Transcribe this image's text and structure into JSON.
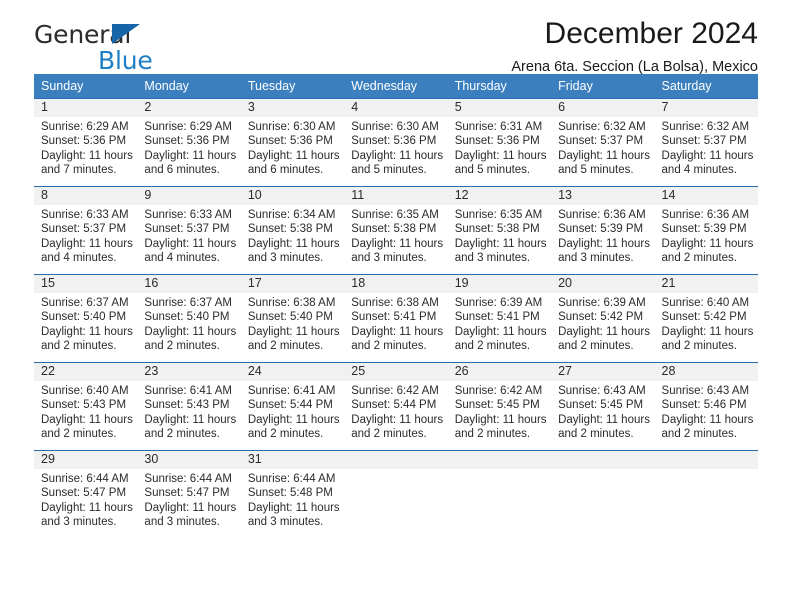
{
  "brand": {
    "line1": "General",
    "line2": "Blue",
    "triangle_color": "#1565a8",
    "blue_color": "#1f7fc4"
  },
  "header": {
    "title": "December 2024",
    "subtitle": "Arena 6ta. Seccion (La Bolsa), Mexico"
  },
  "calendar": {
    "header_bg": "#3b7fbf",
    "weekday_headers": [
      "Sunday",
      "Monday",
      "Tuesday",
      "Wednesday",
      "Thursday",
      "Friday",
      "Saturday"
    ],
    "weeks": [
      [
        {
          "day": "1",
          "sunrise": "Sunrise: 6:29 AM",
          "sunset": "Sunset: 5:36 PM",
          "daylight1": "Daylight: 11 hours",
          "daylight2": "and 7 minutes."
        },
        {
          "day": "2",
          "sunrise": "Sunrise: 6:29 AM",
          "sunset": "Sunset: 5:36 PM",
          "daylight1": "Daylight: 11 hours",
          "daylight2": "and 6 minutes."
        },
        {
          "day": "3",
          "sunrise": "Sunrise: 6:30 AM",
          "sunset": "Sunset: 5:36 PM",
          "daylight1": "Daylight: 11 hours",
          "daylight2": "and 6 minutes."
        },
        {
          "day": "4",
          "sunrise": "Sunrise: 6:30 AM",
          "sunset": "Sunset: 5:36 PM",
          "daylight1": "Daylight: 11 hours",
          "daylight2": "and 5 minutes."
        },
        {
          "day": "5",
          "sunrise": "Sunrise: 6:31 AM",
          "sunset": "Sunset: 5:36 PM",
          "daylight1": "Daylight: 11 hours",
          "daylight2": "and 5 minutes."
        },
        {
          "day": "6",
          "sunrise": "Sunrise: 6:32 AM",
          "sunset": "Sunset: 5:37 PM",
          "daylight1": "Daylight: 11 hours",
          "daylight2": "and 5 minutes."
        },
        {
          "day": "7",
          "sunrise": "Sunrise: 6:32 AM",
          "sunset": "Sunset: 5:37 PM",
          "daylight1": "Daylight: 11 hours",
          "daylight2": "and 4 minutes."
        }
      ],
      [
        {
          "day": "8",
          "sunrise": "Sunrise: 6:33 AM",
          "sunset": "Sunset: 5:37 PM",
          "daylight1": "Daylight: 11 hours",
          "daylight2": "and 4 minutes."
        },
        {
          "day": "9",
          "sunrise": "Sunrise: 6:33 AM",
          "sunset": "Sunset: 5:37 PM",
          "daylight1": "Daylight: 11 hours",
          "daylight2": "and 4 minutes."
        },
        {
          "day": "10",
          "sunrise": "Sunrise: 6:34 AM",
          "sunset": "Sunset: 5:38 PM",
          "daylight1": "Daylight: 11 hours",
          "daylight2": "and 3 minutes."
        },
        {
          "day": "11",
          "sunrise": "Sunrise: 6:35 AM",
          "sunset": "Sunset: 5:38 PM",
          "daylight1": "Daylight: 11 hours",
          "daylight2": "and 3 minutes."
        },
        {
          "day": "12",
          "sunrise": "Sunrise: 6:35 AM",
          "sunset": "Sunset: 5:38 PM",
          "daylight1": "Daylight: 11 hours",
          "daylight2": "and 3 minutes."
        },
        {
          "day": "13",
          "sunrise": "Sunrise: 6:36 AM",
          "sunset": "Sunset: 5:39 PM",
          "daylight1": "Daylight: 11 hours",
          "daylight2": "and 3 minutes."
        },
        {
          "day": "14",
          "sunrise": "Sunrise: 6:36 AM",
          "sunset": "Sunset: 5:39 PM",
          "daylight1": "Daylight: 11 hours",
          "daylight2": "and 2 minutes."
        }
      ],
      [
        {
          "day": "15",
          "sunrise": "Sunrise: 6:37 AM",
          "sunset": "Sunset: 5:40 PM",
          "daylight1": "Daylight: 11 hours",
          "daylight2": "and 2 minutes."
        },
        {
          "day": "16",
          "sunrise": "Sunrise: 6:37 AM",
          "sunset": "Sunset: 5:40 PM",
          "daylight1": "Daylight: 11 hours",
          "daylight2": "and 2 minutes."
        },
        {
          "day": "17",
          "sunrise": "Sunrise: 6:38 AM",
          "sunset": "Sunset: 5:40 PM",
          "daylight1": "Daylight: 11 hours",
          "daylight2": "and 2 minutes."
        },
        {
          "day": "18",
          "sunrise": "Sunrise: 6:38 AM",
          "sunset": "Sunset: 5:41 PM",
          "daylight1": "Daylight: 11 hours",
          "daylight2": "and 2 minutes."
        },
        {
          "day": "19",
          "sunrise": "Sunrise: 6:39 AM",
          "sunset": "Sunset: 5:41 PM",
          "daylight1": "Daylight: 11 hours",
          "daylight2": "and 2 minutes."
        },
        {
          "day": "20",
          "sunrise": "Sunrise: 6:39 AM",
          "sunset": "Sunset: 5:42 PM",
          "daylight1": "Daylight: 11 hours",
          "daylight2": "and 2 minutes."
        },
        {
          "day": "21",
          "sunrise": "Sunrise: 6:40 AM",
          "sunset": "Sunset: 5:42 PM",
          "daylight1": "Daylight: 11 hours",
          "daylight2": "and 2 minutes."
        }
      ],
      [
        {
          "day": "22",
          "sunrise": "Sunrise: 6:40 AM",
          "sunset": "Sunset: 5:43 PM",
          "daylight1": "Daylight: 11 hours",
          "daylight2": "and 2 minutes."
        },
        {
          "day": "23",
          "sunrise": "Sunrise: 6:41 AM",
          "sunset": "Sunset: 5:43 PM",
          "daylight1": "Daylight: 11 hours",
          "daylight2": "and 2 minutes."
        },
        {
          "day": "24",
          "sunrise": "Sunrise: 6:41 AM",
          "sunset": "Sunset: 5:44 PM",
          "daylight1": "Daylight: 11 hours",
          "daylight2": "and 2 minutes."
        },
        {
          "day": "25",
          "sunrise": "Sunrise: 6:42 AM",
          "sunset": "Sunset: 5:44 PM",
          "daylight1": "Daylight: 11 hours",
          "daylight2": "and 2 minutes."
        },
        {
          "day": "26",
          "sunrise": "Sunrise: 6:42 AM",
          "sunset": "Sunset: 5:45 PM",
          "daylight1": "Daylight: 11 hours",
          "daylight2": "and 2 minutes."
        },
        {
          "day": "27",
          "sunrise": "Sunrise: 6:43 AM",
          "sunset": "Sunset: 5:45 PM",
          "daylight1": "Daylight: 11 hours",
          "daylight2": "and 2 minutes."
        },
        {
          "day": "28",
          "sunrise": "Sunrise: 6:43 AM",
          "sunset": "Sunset: 5:46 PM",
          "daylight1": "Daylight: 11 hours",
          "daylight2": "and 2 minutes."
        }
      ],
      [
        {
          "day": "29",
          "sunrise": "Sunrise: 6:44 AM",
          "sunset": "Sunset: 5:47 PM",
          "daylight1": "Daylight: 11 hours",
          "daylight2": "and 3 minutes."
        },
        {
          "day": "30",
          "sunrise": "Sunrise: 6:44 AM",
          "sunset": "Sunset: 5:47 PM",
          "daylight1": "Daylight: 11 hours",
          "daylight2": "and 3 minutes."
        },
        {
          "day": "31",
          "sunrise": "Sunrise: 6:44 AM",
          "sunset": "Sunset: 5:48 PM",
          "daylight1": "Daylight: 11 hours",
          "daylight2": "and 3 minutes."
        },
        {
          "day": "",
          "sunrise": "",
          "sunset": "",
          "daylight1": "",
          "daylight2": ""
        },
        {
          "day": "",
          "sunrise": "",
          "sunset": "",
          "daylight1": "",
          "daylight2": ""
        },
        {
          "day": "",
          "sunrise": "",
          "sunset": "",
          "daylight1": "",
          "daylight2": ""
        },
        {
          "day": "",
          "sunrise": "",
          "sunset": "",
          "daylight1": "",
          "daylight2": ""
        }
      ]
    ]
  }
}
